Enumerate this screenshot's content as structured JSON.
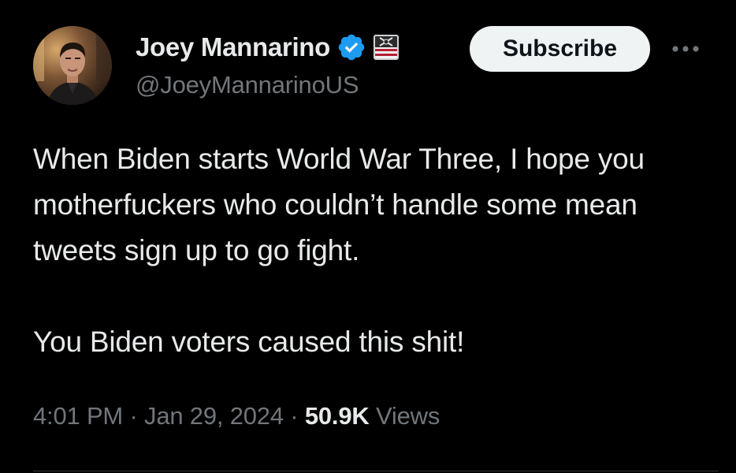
{
  "author": {
    "display_name": "Joey Mannarino",
    "handle": "@JoeyMannarinoUS",
    "verified_icon": "verified-badge-icon",
    "affiliate_icon": "american-flag-badge-icon",
    "avatar": "profile-photo"
  },
  "actions": {
    "subscribe_label": "Subscribe",
    "more_icon": "more-options-icon"
  },
  "tweet": {
    "text": "When Biden starts World War Three, I hope you motherfuckers who couldn’t handle some mean tweets sign up to go fight.\n\nYou Biden voters caused this shit!"
  },
  "meta": {
    "time": "4:01 PM",
    "separator": " · ",
    "date": "Jan 29, 2024",
    "views_count": "50.9K",
    "views_label": " Views"
  },
  "colors": {
    "background": "#000000",
    "primary_text": "#e7e9ea",
    "secondary_text": "#71767b",
    "verified_blue": "#1d9bf0",
    "subscribe_bg": "#eff3f4"
  }
}
